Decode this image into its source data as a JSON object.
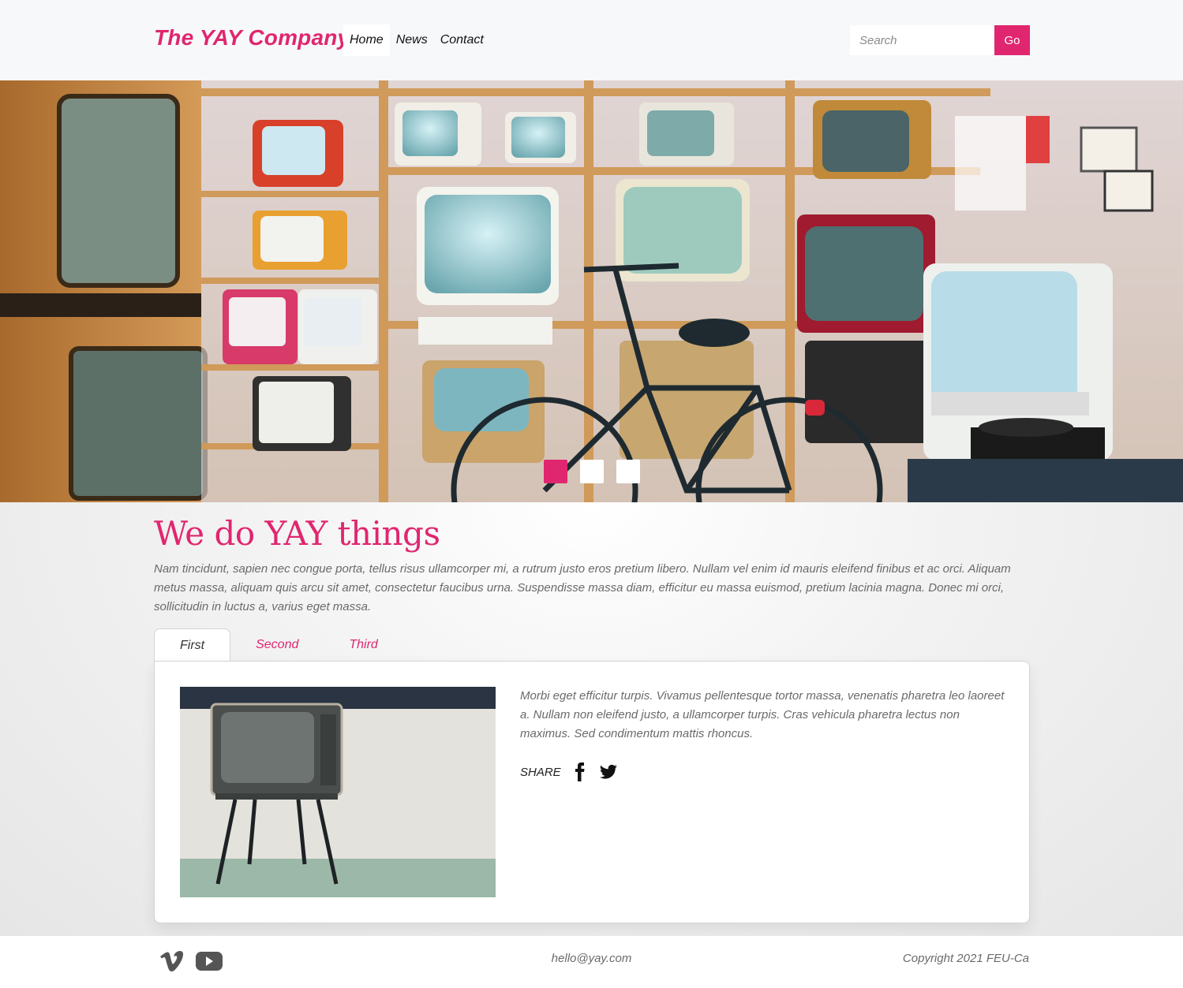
{
  "header": {
    "brand": "The YAY Company",
    "nav": [
      {
        "label": "Home",
        "active": true
      },
      {
        "label": "News",
        "active": false
      },
      {
        "label": "Contact",
        "active": false
      }
    ],
    "search": {
      "placeholder": "Search",
      "value": ""
    },
    "go_label": "Go"
  },
  "hero": {
    "image": "retro-tv-shop-photo",
    "slides": 3,
    "active_slide": 1
  },
  "main": {
    "heading": "We do YAY things",
    "intro": "Nam tincidunt, sapien nec congue porta, tellus risus ullamcorper mi, a rutrum justo eros pretium libero. Nullam vel enim id mauris eleifend finibus et ac orci. Aliquam metus massa, aliquam quis arcu sit amet, consectetur faucibus urna. Suspendisse massa diam, efficitur eu massa euismod, pretium lacinia magna. Donec mi orci, sollicitudin in luctus a, varius eget massa.",
    "tabs": [
      {
        "label": "First",
        "active": true
      },
      {
        "label": "Second",
        "active": false
      },
      {
        "label": "Third",
        "active": false
      }
    ],
    "panel": {
      "image": "vintage-tv-photo",
      "text": "Morbi eget efficitur turpis. Vivamus pellentesque tortor massa, venenatis pharetra leo laoreet a. Nullam non eleifend justo, a ullamcorper turpis. Cras vehicula pharetra lectus non maximus. Sed condimentum mattis rhoncus.",
      "share_label": "SHARE",
      "share_icons": [
        "facebook-icon",
        "twitter-icon"
      ]
    }
  },
  "footer": {
    "icons": [
      "vimeo-icon",
      "youtube-icon"
    ],
    "email": "hello@yay.com",
    "copyright": "Copyright 2021 FEU-Ca"
  },
  "colors": {
    "accent": "#e0266f",
    "header_bg": "#f7f8fa",
    "text_muted": "#6a6a6a"
  }
}
